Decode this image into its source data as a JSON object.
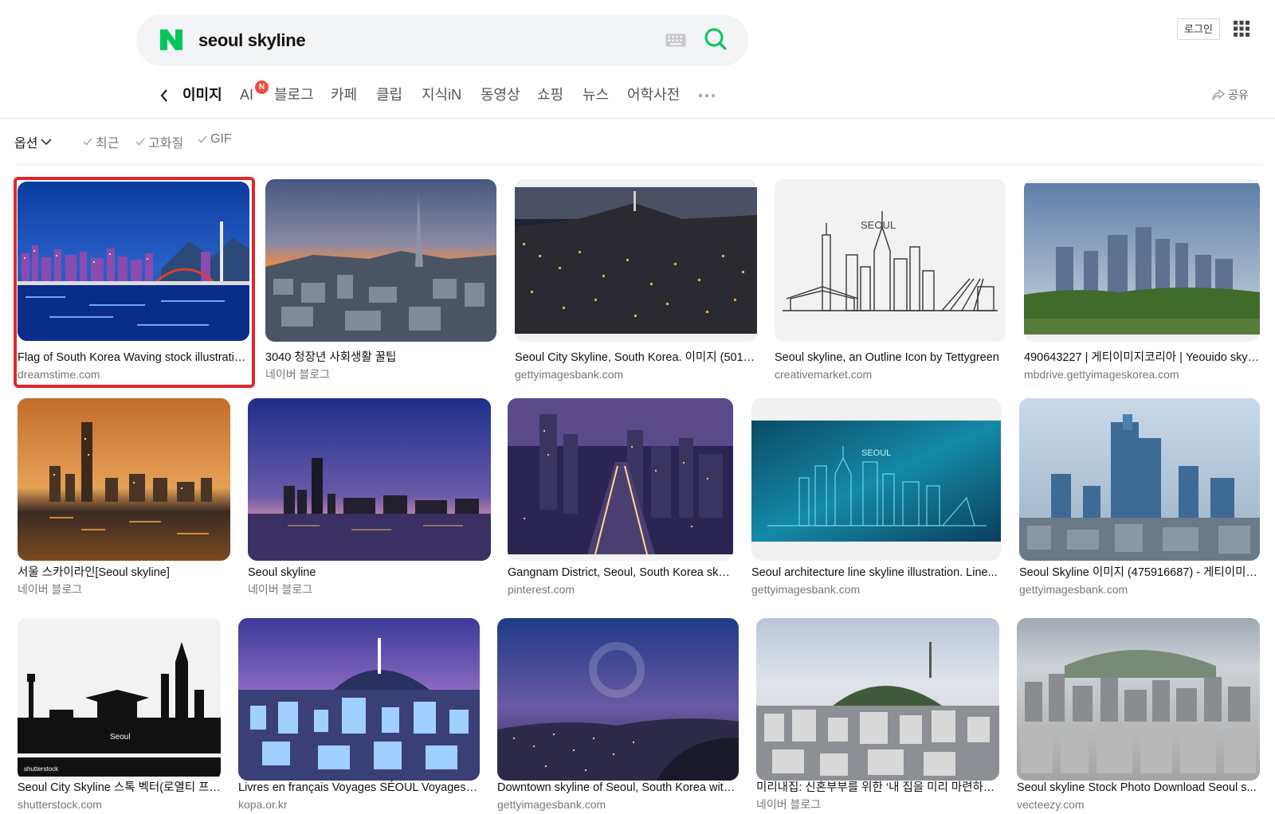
{
  "search": {
    "query": "seoul skyline",
    "brand_color": "#03c75a"
  },
  "header": {
    "login_label": "로그인",
    "share_label": "공유"
  },
  "tabs": [
    {
      "label": "이미지",
      "active": true
    },
    {
      "label": "AI",
      "badge": "N"
    },
    {
      "label": "블로그"
    },
    {
      "label": "카페"
    },
    {
      "label": "클립"
    },
    {
      "label": "지식iN"
    },
    {
      "label": "동영상"
    },
    {
      "label": "쇼핑"
    },
    {
      "label": "뉴스"
    },
    {
      "label": "어학사전"
    }
  ],
  "options": {
    "main_label": "옵션",
    "filters": [
      "최근",
      "고화질",
      "GIF"
    ]
  },
  "results": [
    {
      "title": "Flag of South Korea Waving stock illustratio...",
      "source": "dreamstime.com",
      "selected": true
    },
    {
      "title": "3040 청장년 사회생활 꿀팁",
      "source": "네이버 블로그"
    },
    {
      "title": "Seoul City Skyline, South Korea. 이미지 (5013...",
      "source": "gettyimagesbank.com"
    },
    {
      "title": "Seoul skyline, an Outline Icon by Tettygreen",
      "source": "creativemarket.com",
      "image_text": "SEOUL"
    },
    {
      "title": "490643227 | 게티이미지코리아 | Yeouido skyli...",
      "source": "mbdrive.gettyimageskorea.com"
    },
    {
      "title": "서울 스카이라인[Seoul skyline]",
      "source": "네이버 블로그"
    },
    {
      "title": "Seoul skyline",
      "source": "네이버 블로그"
    },
    {
      "title": "Gangnam District, Seoul, South Korea skyl...",
      "source": "pinterest.com"
    },
    {
      "title": "Seoul architecture line skyline illustration. Line...",
      "source": "gettyimagesbank.com",
      "image_text": "SEOUL"
    },
    {
      "title": "Seoul Skyline 이미지 (475916687) - 게티이미지...",
      "source": "gettyimagesbank.com"
    },
    {
      "title": "Seoul City Skyline 스톡 벡터(로열티 프리...",
      "source": "shutterstock.com",
      "image_text": "Seoul",
      "watermark": "shutterstock"
    },
    {
      "title": "Livres en français Voyages SÉOUL Voyages k...",
      "source": "kopa.or.kr"
    },
    {
      "title": "Downtown skyline of Seoul, South Korea with...",
      "source": "gettyimagesbank.com"
    },
    {
      "title": "미리내집: 신혼부부를 위한 ‘내 집을 미리 마련하는’ ...",
      "source": "네이버 블로그"
    },
    {
      "title": "Seoul skyline Stock Photo Download Seoul s...",
      "source": "vecteezy.com"
    }
  ]
}
